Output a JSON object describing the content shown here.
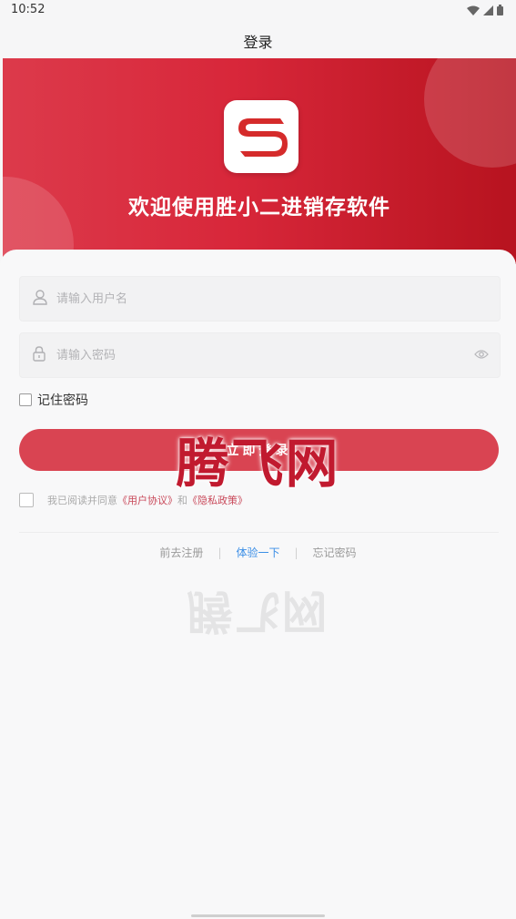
{
  "status_bar": {
    "time": "10:52"
  },
  "nav": {
    "title": "登录"
  },
  "hero": {
    "title": "欢迎使用胜小二进销存软件",
    "logo_letter": "S",
    "accent_color": "#d8273a"
  },
  "form": {
    "username_placeholder": "请输入用户名",
    "password_placeholder": "请输入密码",
    "remember_label": "记住密码",
    "login_label": "立即登录",
    "agree_prefix": "我已阅读并同意",
    "user_agreement": "《用户协议》",
    "and_text": "和",
    "privacy_policy": "《隐私政策》"
  },
  "links": {
    "register": "前去注册",
    "trial": "体验一下",
    "forgot": "忘记密码",
    "separator": "|"
  },
  "watermark": {
    "text": "腾飞网",
    "mirror_text": "腾飞网"
  }
}
